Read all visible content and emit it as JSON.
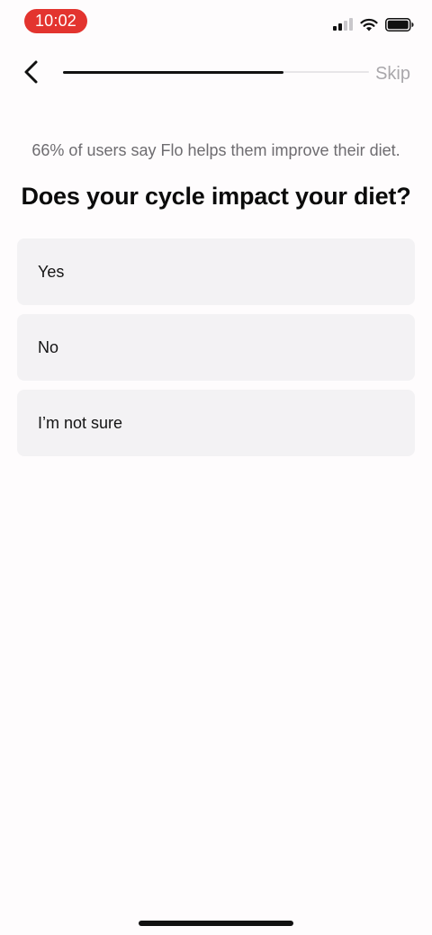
{
  "status_bar": {
    "time": "10:02",
    "icons": [
      "cellular-signal-icon",
      "wifi-icon",
      "battery-icon"
    ],
    "time_pill_color": "#e3342f"
  },
  "header": {
    "back_icon": "chevron-left-icon",
    "progress_percent": 72,
    "skip_label": "Skip"
  },
  "content": {
    "stat_text": "66% of users say Flo helps them improve their diet.",
    "question": "Does your cycle impact your diet?",
    "options": [
      {
        "label": "Yes"
      },
      {
        "label": "No"
      },
      {
        "label": "I’m not sure"
      }
    ]
  }
}
